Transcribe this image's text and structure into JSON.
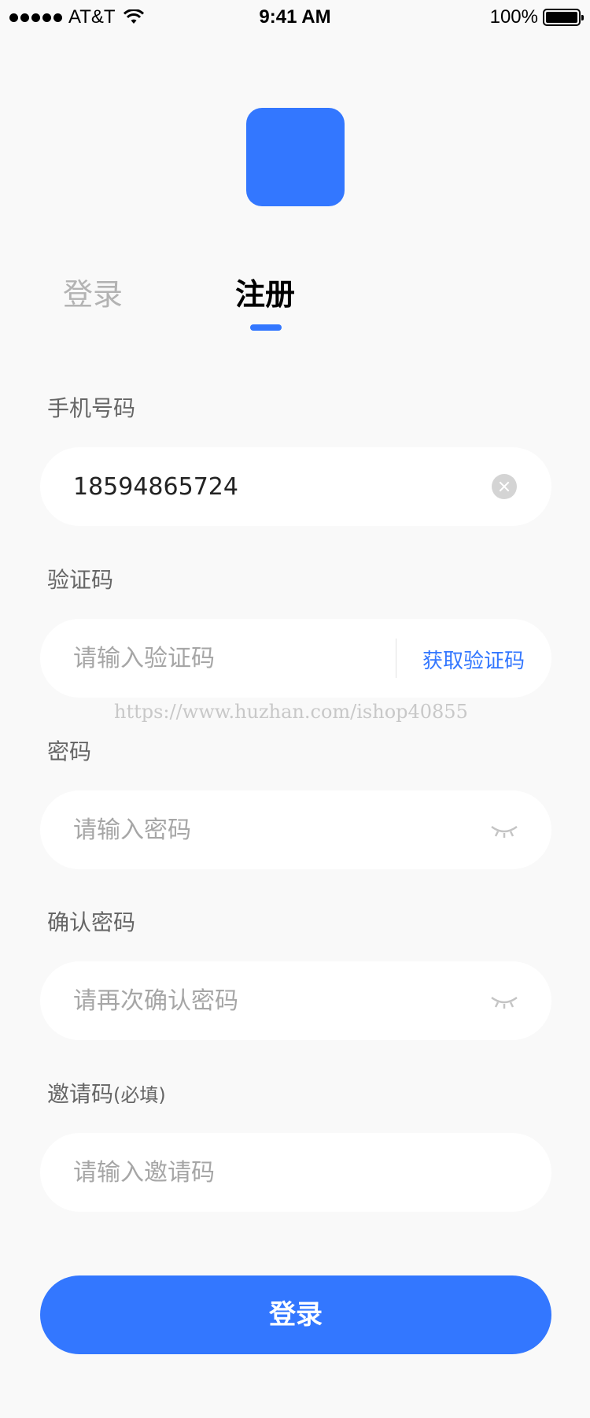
{
  "status_bar": {
    "carrier": "AT&T",
    "time": "9:41 AM",
    "battery": "100%"
  },
  "tabs": [
    {
      "label": "登录",
      "active": false
    },
    {
      "label": "注册",
      "active": true
    }
  ],
  "form": {
    "phone": {
      "label": "手机号码",
      "value": "18594865724"
    },
    "code": {
      "label": "验证码",
      "placeholder": "请输入验证码",
      "action_label": "获取验证码"
    },
    "password": {
      "label": "密码",
      "placeholder": "请输入密码"
    },
    "confirm_password": {
      "label": "确认密码",
      "placeholder": "请再次确认密码"
    },
    "invite": {
      "label": "邀请码",
      "label_note": "(必填)",
      "placeholder": "请输入邀请码"
    }
  },
  "watermark": "https://www.huzhan.com/ishop40855",
  "submit_label": "登录",
  "colors": {
    "accent": "#3377ff",
    "background": "#f9f9f9"
  }
}
